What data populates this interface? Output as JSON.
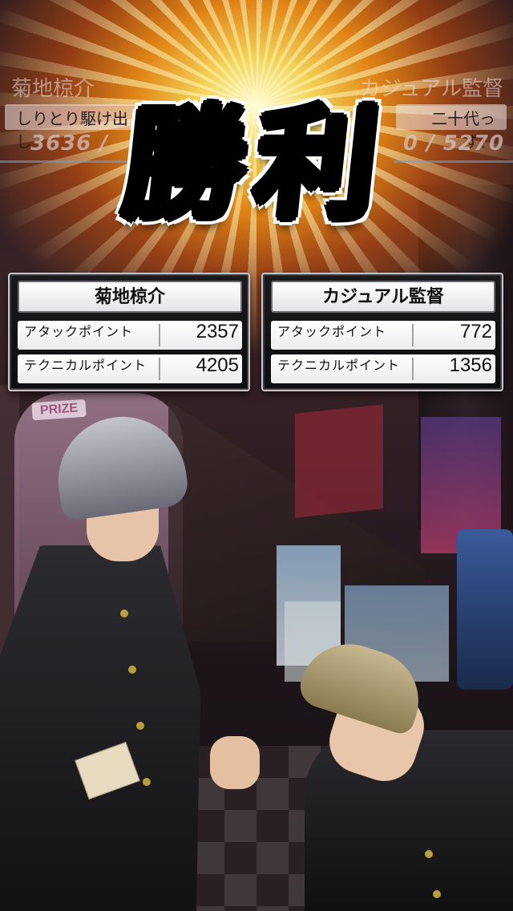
{
  "hud": {
    "left_name": "菊地椋介",
    "left_subtitle": "しりとり駆け出し",
    "left_score": "3636 /",
    "right_name": "カジュアル監督",
    "right_subtitle": "二十代っす！",
    "right_score": "0 / 5270"
  },
  "victory_text": "勝利",
  "background_signs": {
    "prize": "PRIZE"
  },
  "results": {
    "player": {
      "name": "菊地椋介",
      "stats": [
        {
          "label": "アタックポイント",
          "value": "2357"
        },
        {
          "label": "テクニカルポイント",
          "value": "4205"
        }
      ]
    },
    "opponent": {
      "name": "カジュアル監督",
      "stats": [
        {
          "label": "アタックポイント",
          "value": "772"
        },
        {
          "label": "テクニカルポイント",
          "value": "1356"
        }
      ]
    }
  },
  "colors": {
    "victory_red": "#e8231a",
    "burst_orange": "#ff9614",
    "panel_dark": "#1a1a1c"
  }
}
